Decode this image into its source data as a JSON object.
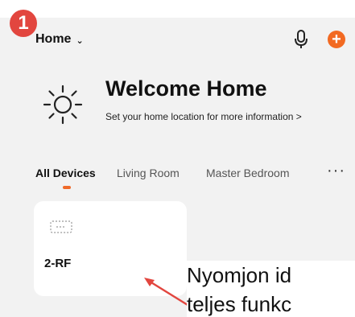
{
  "step_badge": "1",
  "header": {
    "home_label": "Home",
    "home_chevron_icon": "chevron-down-icon",
    "mic_icon": "microphone-icon",
    "add_icon": "add-circle-icon",
    "add_symbol": "+",
    "add_color": "#f26a22"
  },
  "welcome": {
    "icon": "sun-icon",
    "title": "Welcome Home",
    "subtitle": "Set your home location for more information >"
  },
  "tabs": [
    {
      "label": "All Devices",
      "active": true
    },
    {
      "label": "Living Room",
      "active": false
    },
    {
      "label": "Master Bedroom",
      "active": false
    }
  ],
  "tabs_more_icon": "more-icon",
  "tabs_more_symbol": "···",
  "accent_color": "#ef6a2a",
  "device_card": {
    "icon": "rf-remote-icon",
    "name": "2-RF"
  },
  "annotation": {
    "arrow_color": "#e2463f",
    "caption_lines": [
      "Nyomjon id",
      "teljes funkc"
    ]
  },
  "badge_color": "#e2463f"
}
